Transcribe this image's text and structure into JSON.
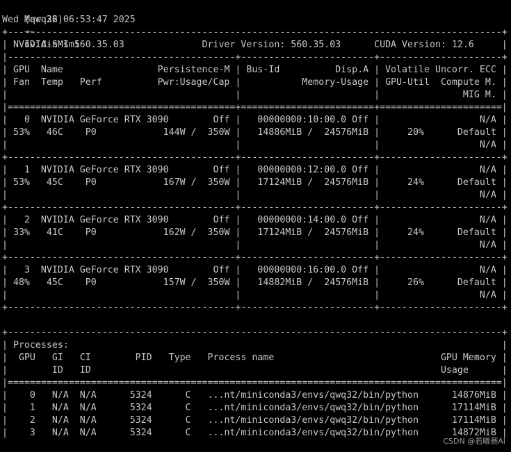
{
  "terminal": {
    "prompt": {
      "env": "(qwq32)",
      "arrow": "➜",
      "tilde": "~",
      "command": "nvidia-smi"
    },
    "lines": [
      "Wed Mar 26 06:53:47 2025",
      "+-----------------------------------------------------------------------------------------+",
      "| NVIDIA-SMI 560.35.03              Driver Version: 560.35.03      CUDA Version: 12.6     |",
      "|-----------------------------------------+------------------------+----------------------+",
      "| GPU  Name                 Persistence-M | Bus-Id          Disp.A | Volatile Uncorr. ECC |",
      "| Fan  Temp   Perf          Pwr:Usage/Cap |           Memory-Usage | GPU-Util  Compute M. |",
      "|                                         |                        |               MIG M. |",
      "|=========================================+========================+======================|",
      "|   0  NVIDIA GeForce RTX 3090        Off |   00000000:10:00.0 Off |                  N/A |",
      "| 53%   46C    P0            144W /  350W |   14886MiB /  24576MiB |     20%      Default |",
      "|                                         |                        |                  N/A |",
      "+-----------------------------------------+------------------------+----------------------+",
      "|   1  NVIDIA GeForce RTX 3090        Off |   00000000:12:00.0 Off |                  N/A |",
      "| 53%   45C    P0            167W /  350W |   17124MiB /  24576MiB |     24%      Default |",
      "|                                         |                        |                  N/A |",
      "+-----------------------------------------+------------------------+----------------------+",
      "|   2  NVIDIA GeForce RTX 3090        Off |   00000000:14:00.0 Off |                  N/A |",
      "| 33%   41C    P0            162W /  350W |   17124MiB /  24576MiB |     24%      Default |",
      "|                                         |                        |                  N/A |",
      "+-----------------------------------------+------------------------+----------------------+",
      "|   3  NVIDIA GeForce RTX 3090        Off |   00000000:16:00.0 Off |                  N/A |",
      "| 48%   45C    P0            157W /  350W |   14882MiB /  24576MiB |     26%      Default |",
      "|                                         |                        |                  N/A |",
      "+-----------------------------------------+------------------------+----------------------+",
      "",
      "+-----------------------------------------------------------------------------------------+",
      "| Processes:                                                                              |",
      "|  GPU   GI   CI        PID   Type   Process name                              GPU Memory |",
      "|        ID   ID                                                               Usage      |",
      "|=========================================================================================|",
      "|    0   N/A  N/A      5324      C   ...nt/miniconda3/envs/qwq32/bin/python      14876MiB |",
      "|    1   N/A  N/A      5324      C   ...nt/miniconda3/envs/qwq32/bin/python      17114MiB |",
      "|    2   N/A  N/A      5324      C   ...nt/miniconda3/envs/qwq32/bin/python      17114MiB |",
      "|    3   N/A  N/A      5324      C   ...nt/miniconda3/envs/qwq32/bin/python      14872MiB |"
    ]
  },
  "watermark": "CSDN @若曦赛AI",
  "colors": {
    "background": "#000000",
    "text": "#c8c8c8",
    "prompt_arrow": "#2ec82e",
    "prompt_tilde": "#35c9c9"
  }
}
